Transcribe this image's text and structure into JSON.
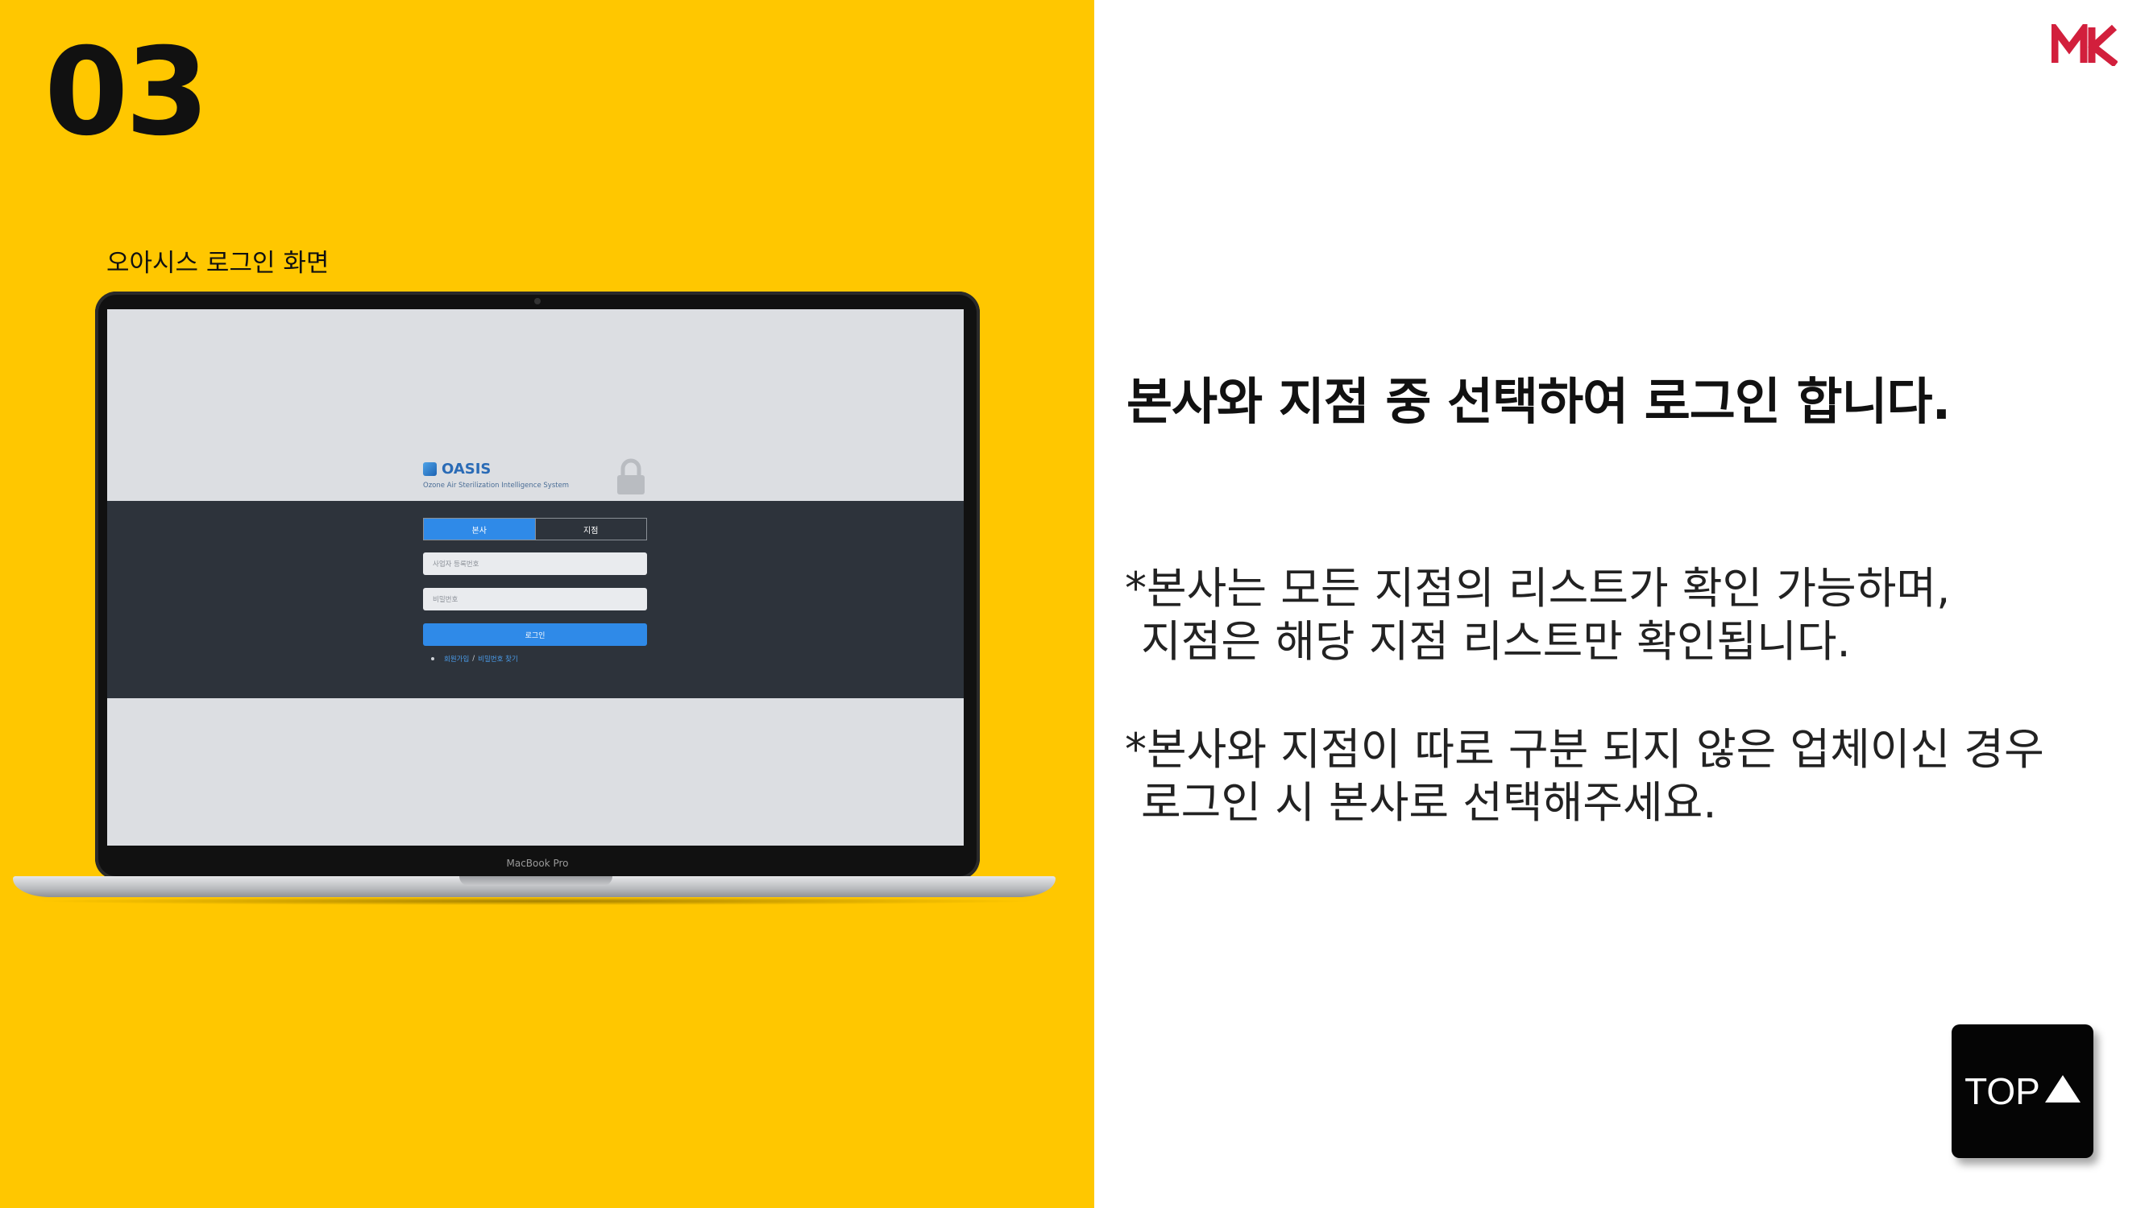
{
  "step": "03",
  "caption": "오아시스 로그인 화면",
  "laptop": {
    "model_label": "MacBook Pro"
  },
  "login_screen": {
    "brand_name": "OASIS",
    "brand_subtitle": "Ozone Air Sterilization Intelligence System",
    "tabs": [
      {
        "label": "본사",
        "active": true
      },
      {
        "label": "지점",
        "active": false
      }
    ],
    "business_number_placeholder": "사업자 등록번호",
    "password_placeholder": "비밀번호",
    "login_button": "로그인",
    "signup_link": "회원가입",
    "link_separator": "/",
    "find_password_link": "비밀번호 찾기",
    "colors": {
      "accent": "#2f8ae8",
      "dark_band": "#2d333b",
      "screen_bg": "#dcdee2"
    }
  },
  "brand_logo": {
    "text": "MK",
    "color": "#d21f3c"
  },
  "headline": "본사와 지점 중 선택하여 로그인 합니다.",
  "notes": [
    {
      "line1": "*본사는 모든 지점의 리스트가 확인 가능하며,",
      "line2": "지점은 해당 지점 리스트만 확인됩니다."
    },
    {
      "line1": "*본사와 지점이 따로 구분 되지 않은 업체이신 경우",
      "line2": "로그인 시 본사로 선택해주세요."
    }
  ],
  "top_button": {
    "label": "TOP",
    "icon": "triangle-up-icon"
  },
  "colors": {
    "left_panel": "#ffc700",
    "right_panel": "#ffffff"
  }
}
